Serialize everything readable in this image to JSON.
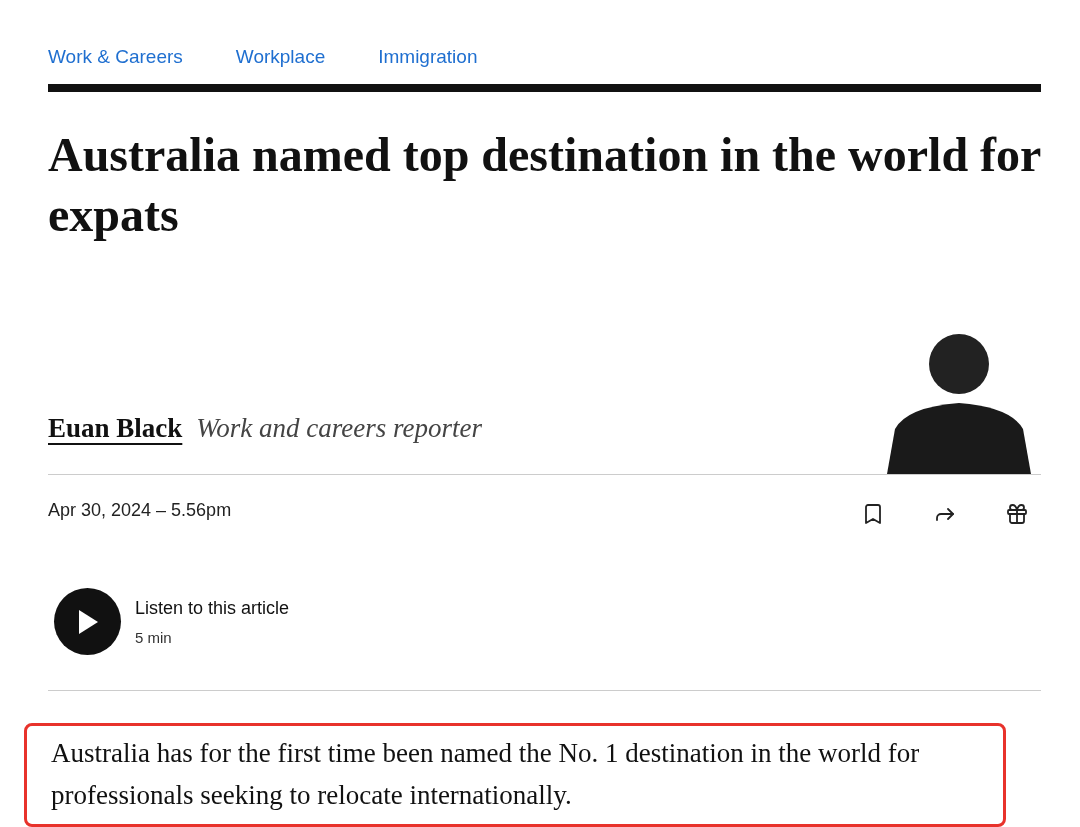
{
  "nav": [
    {
      "label": "Work & Careers"
    },
    {
      "label": "Workplace"
    },
    {
      "label": "Immigration"
    }
  ],
  "headline": "Australia named top destination in the world for expats",
  "author": {
    "name": "Euan Black",
    "role": "Work and careers reporter"
  },
  "date": "Apr 30, 2024 – 5.56pm",
  "actions": [
    {
      "kind": "bookmark"
    },
    {
      "kind": "share"
    },
    {
      "kind": "gift"
    }
  ],
  "audio": {
    "title": "Listen to this article",
    "duration": "5 min"
  },
  "lead": {
    "text": "Australia has for the first time been named the No. 1 destination in the world for professionals seeking to relocate internationally.",
    "highlighted": true
  }
}
